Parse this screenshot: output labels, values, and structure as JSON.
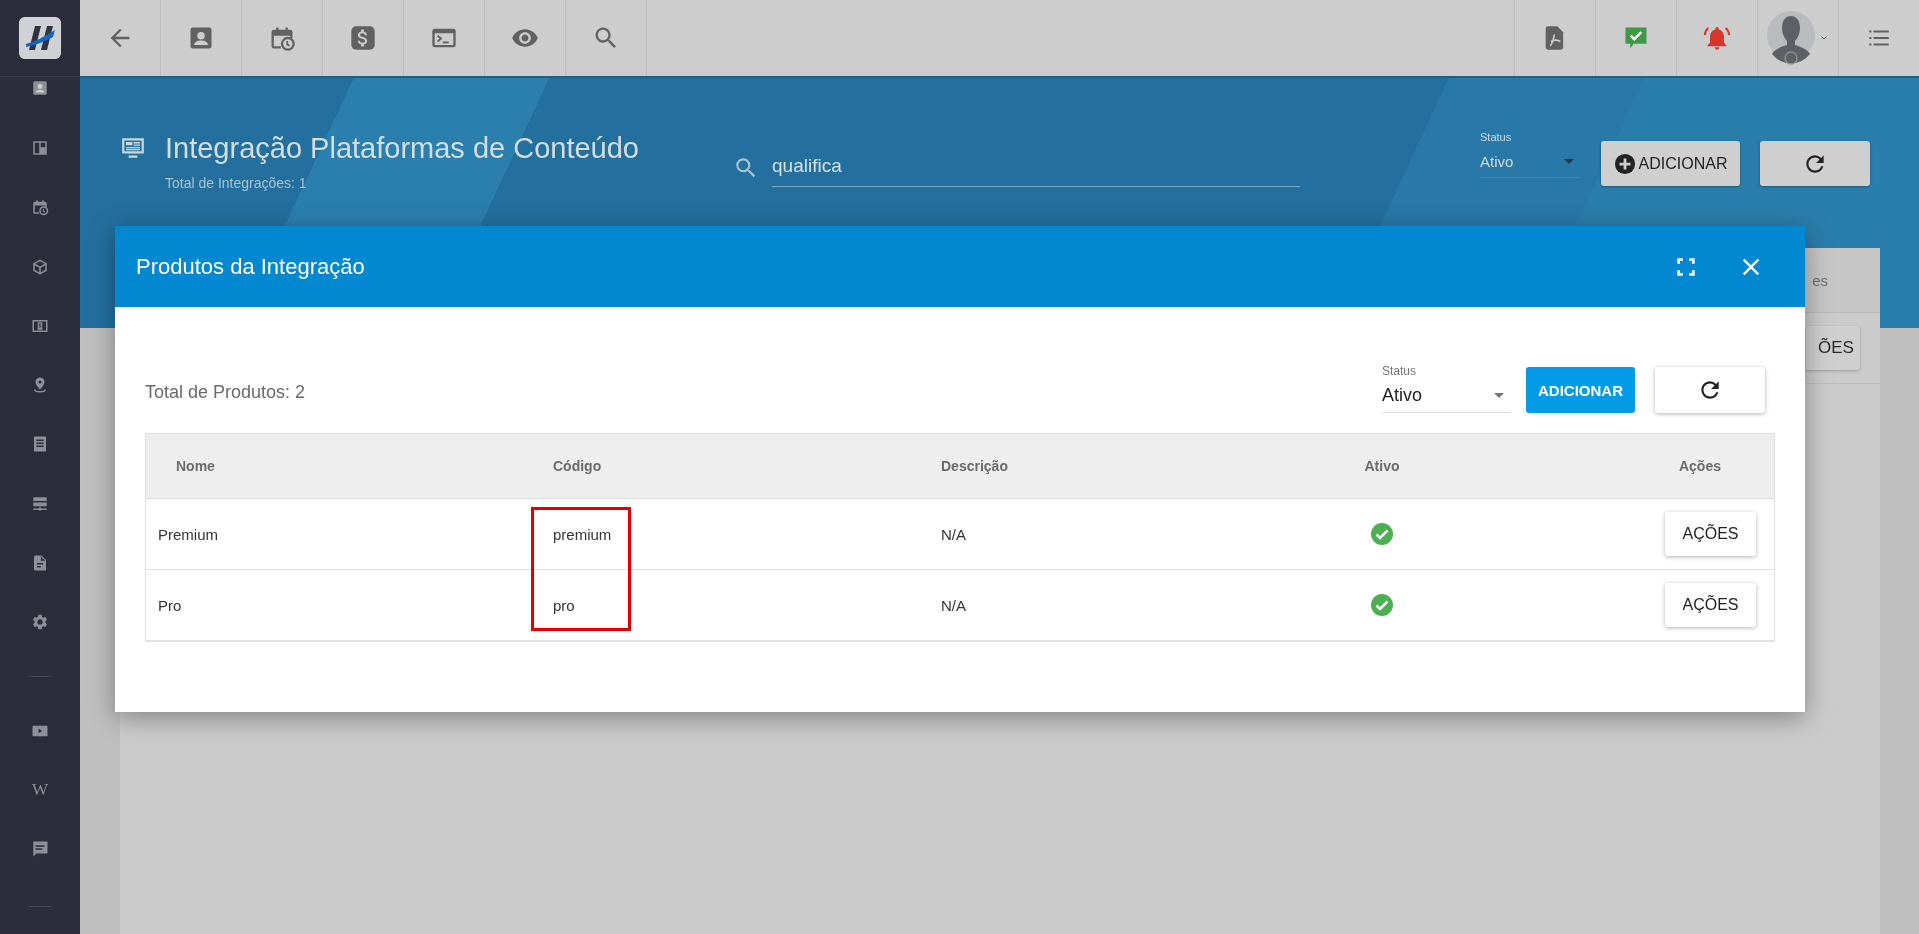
{
  "sidebar": {
    "text_icon": "W"
  },
  "page": {
    "title": "Integração Plataformas de Conteúdo",
    "subtitle": "Total de Integrações: 1",
    "search": {
      "value": "qualifica"
    },
    "status": {
      "label": "Status",
      "value": "Ativo"
    },
    "add_button": "ADICIONAR"
  },
  "background_card": {
    "header_fragment": "es",
    "button_fragment": "ÕES"
  },
  "modal": {
    "title": "Produtos da Integração",
    "total": "Total de Produtos: 2",
    "status": {
      "label": "Status",
      "value": "Ativo"
    },
    "add_button": "ADICIONAR",
    "table": {
      "columns": [
        {
          "label": "Nome",
          "highlighted": false
        },
        {
          "label": "Código",
          "highlighted": true
        },
        {
          "label": "Descrição",
          "highlighted": false
        },
        {
          "label": "Ativo",
          "highlighted": false
        },
        {
          "label": "Ações",
          "highlighted": false
        }
      ],
      "rows": [
        {
          "nome": "Premium",
          "codigo": "premium",
          "descricao": "N/A",
          "ativo": true,
          "action": "AÇÕES"
        },
        {
          "nome": "Pro",
          "codigo": "pro",
          "descricao": "N/A",
          "ativo": true,
          "action": "AÇÕES"
        }
      ]
    }
  }
}
